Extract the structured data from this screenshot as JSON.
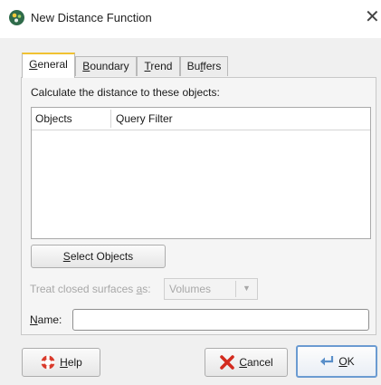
{
  "window": {
    "title": "New Distance Function",
    "close_glyph": "✕"
  },
  "tabs": [
    {
      "label_mn": "G",
      "label_rest": "eneral"
    },
    {
      "label_mn": "B",
      "label_rest": "oundary"
    },
    {
      "label_mn": "T",
      "label_rest": "rend"
    },
    {
      "label_pre": "Bu",
      "label_mn": "f",
      "label_rest": "fers"
    }
  ],
  "general": {
    "calc_label": "Calculate the distance to these objects:",
    "columns": [
      "Objects",
      "Query Filter"
    ],
    "select_btn": {
      "mn": "S",
      "rest": "elect Objects"
    },
    "treat_label": {
      "pre": "Treat closed surfaces ",
      "mn": "a",
      "rest": "s:"
    },
    "treat_value": "Volumes",
    "name_label": {
      "mn": "N",
      "rest": "ame:"
    },
    "name_value": ""
  },
  "buttons": {
    "help": {
      "mn": "H",
      "rest": "elp"
    },
    "cancel": {
      "mn": "C",
      "rest": "ancel"
    },
    "ok": {
      "mn": "O",
      "rest": "K"
    }
  },
  "icons": {
    "app": "leapfrog-app-icon",
    "help": "lifebuoy-icon",
    "cancel": "red-x-icon",
    "ok": "return-arrow-icon"
  },
  "colors": {
    "active_tab_accent": "#f1c232",
    "ok_border": "#6b9bd1",
    "disabled_text": "#a8a8a8"
  }
}
